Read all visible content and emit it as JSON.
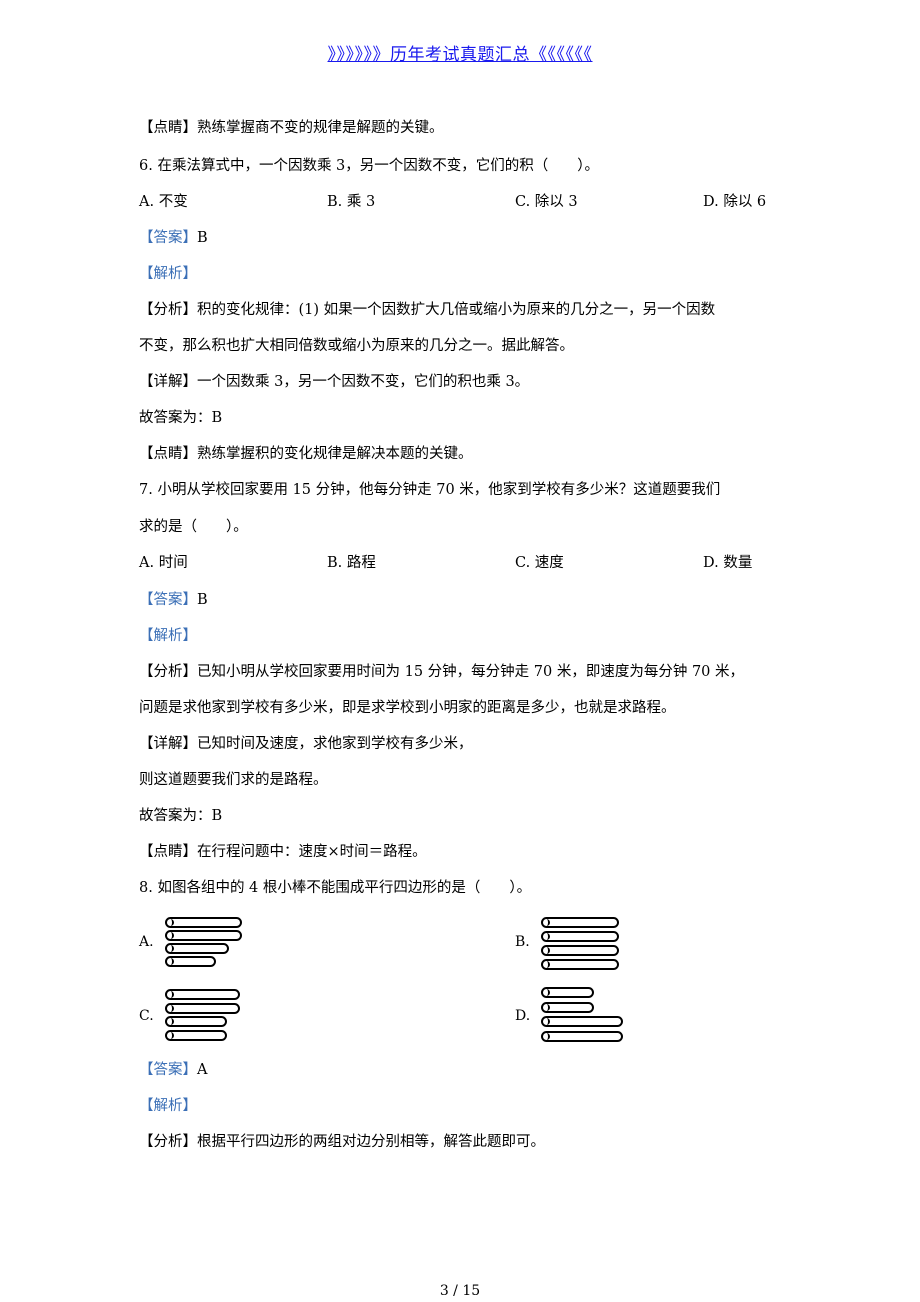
{
  "header": {
    "link_text": "》》》》》》历年考试真题汇总《《《《《《"
  },
  "blocks": {
    "q5_point": {
      "tag": "【点睛】",
      "text": "熟练掌握商不变的规律是解题的关键。"
    },
    "q6": {
      "stem": "6. 在乘法算式中，一个因数乘 3，另一个因数不变，它们的积（　　）。",
      "options": [
        "A. 不变",
        "B. 乘 3",
        "C. 除以 3",
        "D. 除以 6"
      ],
      "answer_tag": "【答案】",
      "answer": "B",
      "analysis_tag": "【解析】",
      "fenxi_tag": "【分析】",
      "fenxi_1": "积的变化规律：(1) 如果一个因数扩大几倍或缩小为原来的几分之一，另一个因数",
      "fenxi_2": "不变，那么积也扩大相同倍数或缩小为原来的几分之一。据此解答。",
      "detail_tag": "【详解】",
      "detail": "一个因数乘 3，另一个因数不变，它们的积也乘 3。",
      "final": "故答案为：B",
      "point_tag": "【点睛】",
      "point": "熟练掌握积的变化规律是解决本题的关键。"
    },
    "q7": {
      "stem_1": "7. 小明从学校回家要用 15 分钟，他每分钟走 70 米，他家到学校有多少米？这道题要我们",
      "stem_2": "求的是（　　）。",
      "options": [
        "A. 时间",
        "B. 路程",
        "C. 速度",
        "D. 数量"
      ],
      "answer_tag": "【答案】",
      "answer": "B",
      "analysis_tag": "【解析】",
      "fenxi_tag": "【分析】",
      "fenxi_1": "已知小明从学校回家要用时间为 15 分钟，每分钟走 70 米，即速度为每分钟 70 米，",
      "fenxi_2": "问题是求他家到学校有多少米，即是求学校到小明家的距离是多少，也就是求路程。",
      "detail_tag": "【详解】",
      "detail_1": "已知时间及速度，求他家到学校有多少米，",
      "detail_2": "则这道题要我们求的是路程。",
      "final": "故答案为：B",
      "point_tag": "【点睛】",
      "point": "在行程问题中：速度×时间＝路程。"
    },
    "q8": {
      "stem": "8. 如图各组中的 4 根小棒不能围成平行四边形的是（　　）。",
      "figures": [
        {
          "label": "A.",
          "stick_lengths": [
            "long",
            "long",
            "medium",
            "short"
          ]
        },
        {
          "label": "B.",
          "stick_lengths": [
            "long",
            "long",
            "long",
            "long"
          ]
        },
        {
          "label": "C.",
          "stick_lengths": [
            "long",
            "long",
            "medium",
            "medium"
          ]
        },
        {
          "label": "D.",
          "stick_lengths": [
            "short",
            "short",
            "long",
            "long"
          ]
        }
      ],
      "answer_tag": "【答案】",
      "answer": "A",
      "analysis_tag": "【解析】",
      "fenxi_tag": "【分析】",
      "fenxi": "根据平行四边形的两组对边分别相等，解答此题即可。"
    }
  },
  "footer": {
    "page": "3 / 15"
  }
}
